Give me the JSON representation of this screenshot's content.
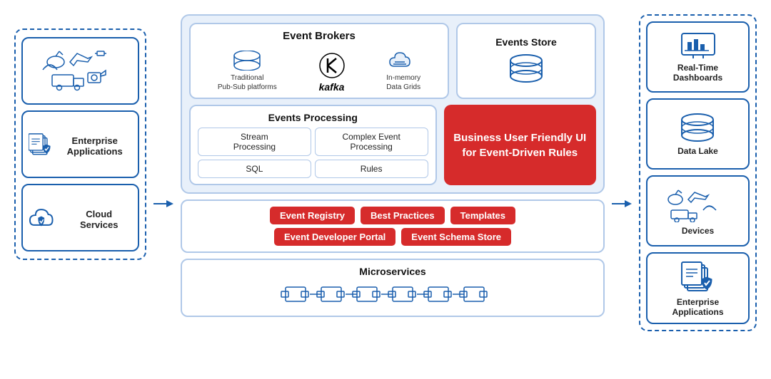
{
  "left": {
    "cards": [
      {
        "id": "iot-devices",
        "label": ""
      },
      {
        "id": "enterprise-apps",
        "label": "Enterprise\nApplications"
      },
      {
        "id": "cloud-services",
        "label": "Cloud\nServices"
      }
    ]
  },
  "middle": {
    "event_brokers": {
      "title": "Event Brokers",
      "items": [
        {
          "id": "pub-sub",
          "label": "Traditional\nPub-Sub platforms"
        },
        {
          "id": "kafka",
          "label": "kafka"
        },
        {
          "id": "in-memory",
          "label": "In-memory\nData Grids"
        }
      ]
    },
    "events_store": {
      "title": "Events Store"
    },
    "events_processing": {
      "title": "Events Processing",
      "cells": [
        "Stream\nProcessing",
        "Complex Event\nProcessing",
        "SQL",
        "Rules"
      ]
    },
    "business_ui": {
      "text": "Business User Friendly\nUI for Event-Driven\nRules"
    },
    "portal": {
      "tags_row1": [
        "Event Registry",
        "Best Practices",
        "Templates"
      ],
      "tags_row2": [
        "Event Developer Portal",
        "Event Schema Store"
      ]
    },
    "microservices": {
      "title": "Microservices"
    }
  },
  "right": {
    "cards": [
      {
        "id": "realtime-dashboards",
        "label": "Real-Time\nDashboards"
      },
      {
        "id": "data-lake",
        "label": "Data Lake"
      },
      {
        "id": "devices",
        "label": "Devices"
      },
      {
        "id": "enterprise-apps-right",
        "label": "Enterprise\nApplications"
      }
    ]
  }
}
